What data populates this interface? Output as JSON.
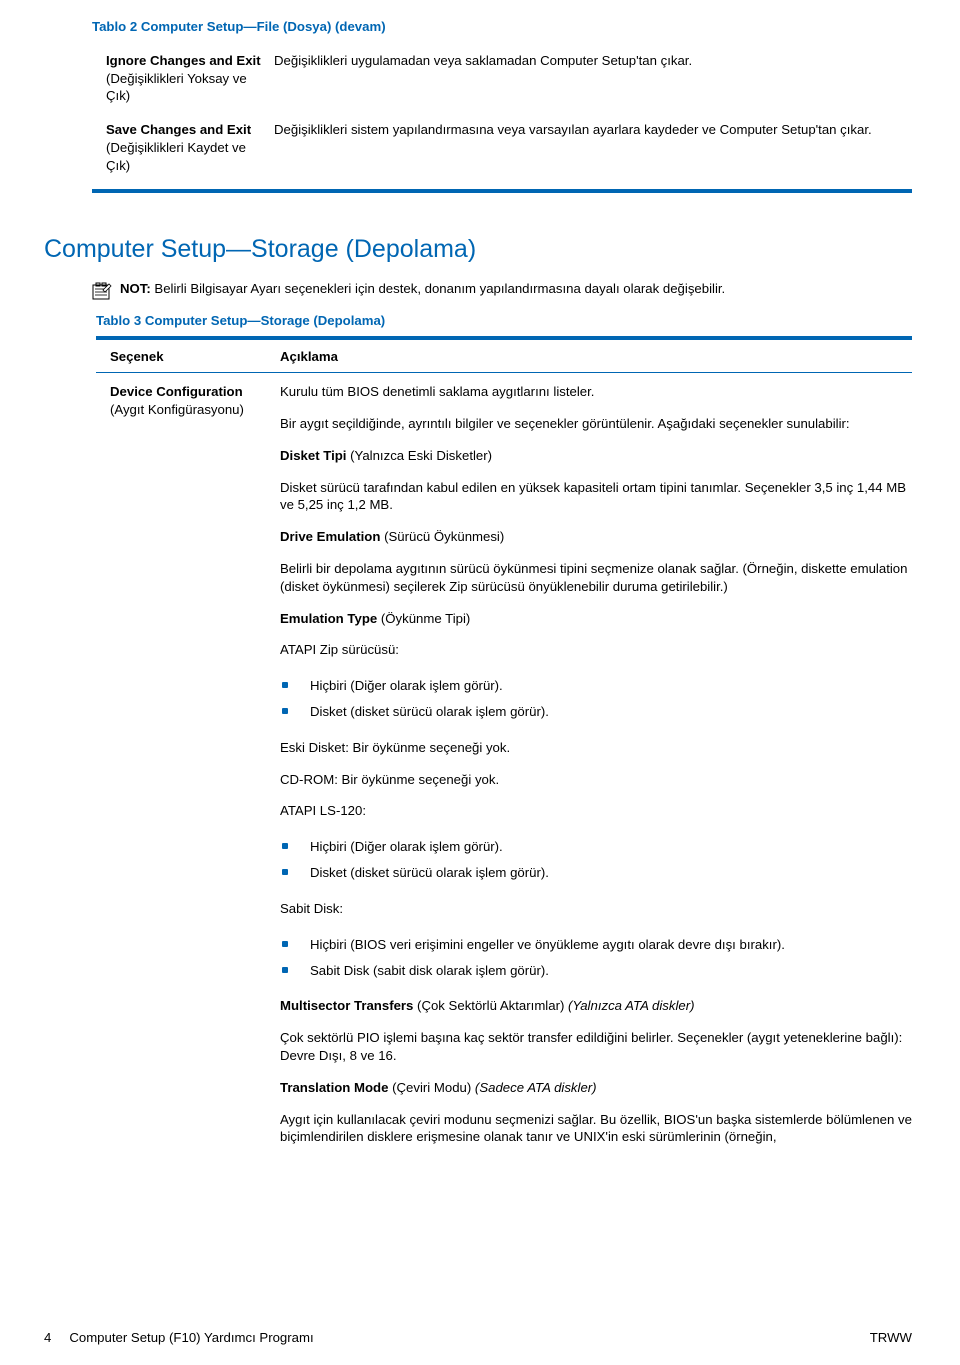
{
  "table2": {
    "title": "Tablo 2  Computer Setup—File (Dosya) (devam)",
    "rows": [
      {
        "c1_bold": "Ignore Changes and Exit",
        "c1_rest": " (Değişiklikleri Yoksay ve Çık)",
        "c2": "Değişiklikleri uygulamadan veya saklamadan Computer Setup'tan çıkar."
      },
      {
        "c1_bold": "Save Changes and Exit",
        "c1_rest": " (Değişiklikleri Kaydet ve Çık)",
        "c2": "Değişiklikleri sistem yapılandırmasına veya varsayılan ayarlara kaydeder ve Computer Setup'tan çıkar."
      }
    ]
  },
  "section_title": "Computer Setup—Storage (Depolama)",
  "note": {
    "label": "NOT:",
    "text": "   Belirli Bilgisayar Ayarı seçenekleri için destek, donanım yapılandırmasına dayalı olarak değişebilir."
  },
  "table3": {
    "title": "Tablo 3  Computer Setup—Storage (Depolama)",
    "head1": "Seçenek",
    "head2": "Açıklama",
    "left_bold": "Device Configuration",
    "left_rest": " (Aygıt Konfigürasyonu)",
    "p1": "Kurulu tüm BIOS denetimli saklama aygıtlarını listeler.",
    "p2": "Bir aygıt seçildiğinde, ayrıntılı bilgiler ve seçenekler görüntülenir. Aşağıdaki seçenekler sunulabilir:",
    "disket_head": "Disket Tipi ",
    "disket_head_rest": "(Yalnızca Eski Disketler)",
    "disket_body": "Disket sürücü tarafından kabul edilen en yüksek kapasiteli ortam tipini tanımlar. Seçenekler 3,5 inç 1,44 MB ve 5,25 inç 1,2 MB.",
    "drive_emu_head": "Drive Emulation",
    "drive_emu_head_rest": " (Sürücü Öykünmesi)",
    "drive_emu_body": "Belirli bir depolama aygıtının sürücü öykünmesi tipini seçmenize olanak sağlar. (Örneğin, diskette emulation (disket öykünmesi) seçilerek Zip sürücüsü önyüklenebilir duruma getirilebilir.)",
    "emu_type_head": "Emulation Type",
    "emu_type_head_rest": " (Öykünme Tipi)",
    "atapi_zip_label": "ATAPI Zip sürücüsü:",
    "zip_items": [
      "Hiçbiri (Diğer olarak işlem görür).",
      "Disket (disket sürücü olarak işlem görür)."
    ],
    "eski_disket": "Eski Disket: Bir öykünme seçeneği yok.",
    "cdrom": "CD-ROM: Bir öykünme seçeneği yok.",
    "atapi_ls": "ATAPI LS-120:",
    "ls_items": [
      "Hiçbiri (Diğer olarak işlem görür).",
      "Disket (disket sürücü olarak işlem görür)."
    ],
    "sabit_disk": "Sabit Disk:",
    "sabit_items": [
      "Hiçbiri (BIOS veri erişimini engeller ve önyükleme aygıtı olarak devre dışı bırakır).",
      "Sabit Disk (sabit disk olarak işlem görür)."
    ],
    "multisector_head": "Multisector Transfers",
    "multisector_rest": " (Çok Sektörlü Aktarımlar) ",
    "multisector_italic": "(Yalnızca ATA diskler)",
    "multisector_body": "Çok sektörlü PIO işlemi başına kaç sektör transfer edildiğini belirler. Seçenekler (aygıt yeteneklerine bağlı): Devre Dışı, 8 ve 16.",
    "transmode_head": "Translation Mode",
    "transmode_rest": " (Çeviri Modu) ",
    "transmode_italic": "(Sadece ATA diskler)",
    "transmode_body": "Aygıt için kullanılacak çeviri modunu seçmenizi sağlar. Bu özellik, BIOS'un başka sistemlerde bölümlenen ve biçimlendirilen disklere erişmesine olanak tanır ve UNIX'in eski sürümlerinin (örneğin,"
  },
  "footer": {
    "page": "4",
    "chapter": "Computer Setup (F10) Yardımcı Programı",
    "right": "TRWW"
  }
}
